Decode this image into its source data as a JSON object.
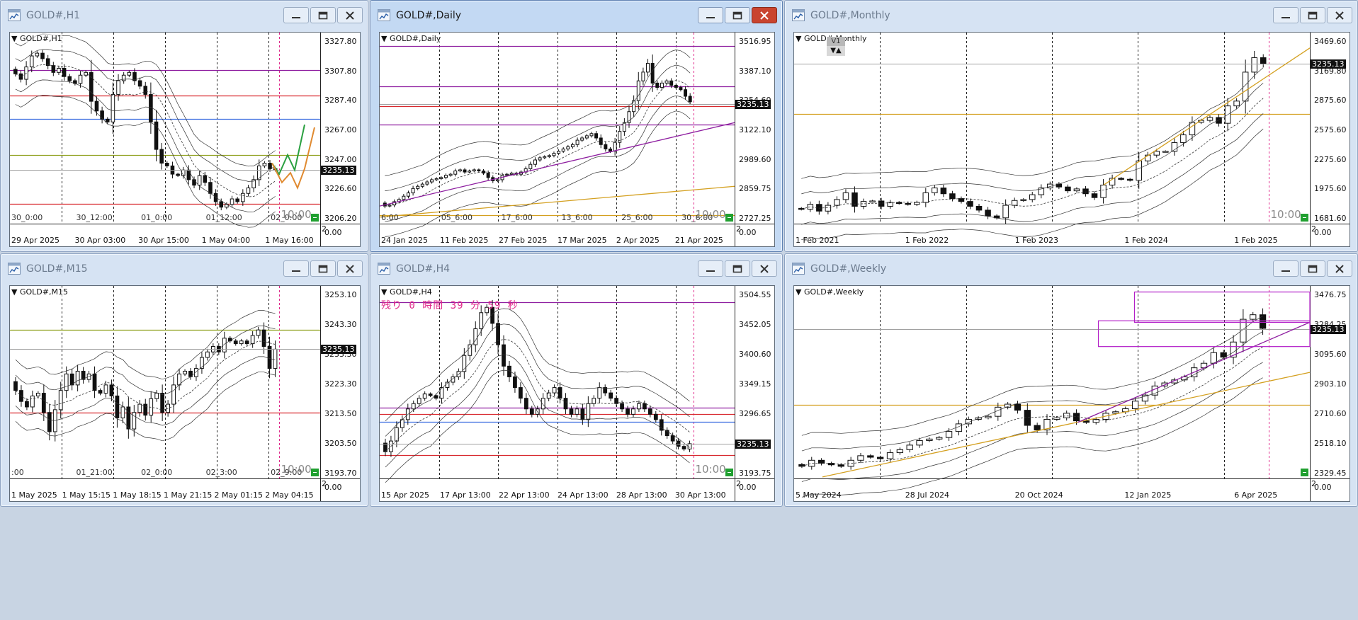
{
  "windows": [
    {
      "title": "GOLD#,H1",
      "symbol": "GOLD#,H1",
      "active": false,
      "price_labels": [
        "3327.80",
        "3307.80",
        "3287.40",
        "3267.00",
        "3247.00",
        "3226.60",
        "3206.20"
      ],
      "current_price": "3235.13",
      "inner_ticks": [
        "30_0:00",
        "30_12:00",
        "01_0:00",
        "01_12:00",
        "02_0:00"
      ],
      "axis_labels": [
        "29 Apr 2025",
        "30 Apr 03:00",
        "30 Apr 15:00",
        "1 May 04:00",
        "1 May 16:00"
      ],
      "time_label": "10:00",
      "scale_top": "2",
      "scale_bottom": "0.00",
      "chart_data": {
        "type": "candlestick",
        "symbol": "GOLD#",
        "timeframe": "H1",
        "y_range": [
          3196,
          3335
        ],
        "last": 3235.13,
        "closes": [
          3305,
          3301,
          3310,
          3318,
          3320,
          3316,
          3311,
          3306,
          3309,
          3303,
          3300,
          3298,
          3304,
          3306,
          3285,
          3278,
          3272,
          3270,
          3290,
          3300,
          3304,
          3306,
          3300,
          3296,
          3290,
          3270,
          3250,
          3240,
          3238,
          3232,
          3231,
          3235,
          3228,
          3224,
          3231,
          3226,
          3218,
          3212,
          3208,
          3210,
          3214,
          3212,
          3218,
          3222,
          3228,
          3238,
          3240,
          3236,
          3235
        ]
      },
      "horizontal_lines": [
        {
          "price": 3307.5,
          "color": "#8e1ea0"
        },
        {
          "price": 3289.0,
          "color": "#d8292f"
        },
        {
          "price": 3272.0,
          "color": "#3a6ce0"
        },
        {
          "price": 3246.0,
          "color": "#8fa01e"
        },
        {
          "price": 3210.5,
          "color": "#d8292f"
        }
      ]
    },
    {
      "title": "GOLD#,Daily",
      "symbol": "GOLD#,Daily",
      "active": true,
      "price_labels": [
        "3516.95",
        "3387.10",
        "3254.60",
        "3122.10",
        "2989.60",
        "2859.75",
        "2727.25"
      ],
      "current_price": "3235.13",
      "inner_ticks": [
        "6:00",
        "05_6:00",
        "17_6:00",
        "13_6:00",
        "25_6:00",
        "30_6:00"
      ],
      "axis_labels": [
        "24 Jan 2025",
        "11 Feb 2025",
        "27 Feb 2025",
        "17 Mar 2025",
        "2 Apr 2025",
        "21 Apr 2025"
      ],
      "time_label": "10:00",
      "scale_top": "2",
      "scale_bottom": "0.00",
      "chart_data": {
        "type": "candlestick",
        "symbol": "GOLD#",
        "timeframe": "D1",
        "y_range": [
          2690,
          3560
        ],
        "last": 3235.13,
        "closes": [
          2770,
          2775,
          2790,
          2800,
          2815,
          2830,
          2850,
          2860,
          2870,
          2880,
          2890,
          2895,
          2900,
          2910,
          2915,
          2930,
          2935,
          2925,
          2930,
          2935,
          2930,
          2920,
          2900,
          2885,
          2890,
          2910,
          2915,
          2920,
          2915,
          2925,
          2940,
          2960,
          2980,
          2990,
          2995,
          3000,
          3010,
          3020,
          3030,
          3040,
          3050,
          3070,
          3080,
          3090,
          3100,
          3080,
          3050,
          3030,
          3020,
          3060,
          3110,
          3150,
          3200,
          3250,
          3340,
          3380,
          3420,
          3330,
          3310,
          3330,
          3340,
          3320,
          3310,
          3300,
          3270,
          3245
        ]
      },
      "horizontal_lines": [
        {
          "price": 3500,
          "color": "#8e1ea0"
        },
        {
          "price": 3316,
          "color": "#8e1ea0"
        },
        {
          "price": 3226,
          "color": "#d8292f"
        },
        {
          "price": 3142,
          "color": "#8e1ea0"
        },
        {
          "price": 2730,
          "color": "#d4a020"
        }
      ]
    },
    {
      "title": "GOLD#,Monthly",
      "symbol": "GOLD#,Monthly",
      "active": false,
      "price_labels": [
        "3469.60",
        "3169.80",
        "2875.60",
        "2575.60",
        "2275.60",
        "1975.60",
        "1681.60"
      ],
      "current_price": "3235.13",
      "inner_ticks": [],
      "axis_labels": [
        "1 Feb 2021",
        "1 Feb 2022",
        "1 Feb 2023",
        "1 Feb 2024",
        "1 Feb 2025"
      ],
      "time_label": "10:00",
      "scale_top": "2",
      "scale_bottom": "0.00",
      "badge": "V1",
      "chart_data": {
        "type": "candlestick",
        "symbol": "GOLD#",
        "timeframe": "MN",
        "y_range": [
          1580,
          3560
        ],
        "last": 3235.13,
        "closes": [
          1730,
          1780,
          1710,
          1770,
          1830,
          1900,
          1760,
          1810,
          1815,
          1760,
          1800,
          1790,
          1780,
          1800,
          1900,
          1950,
          1890,
          1840,
          1810,
          1760,
          1720,
          1660,
          1640,
          1770,
          1820,
          1830,
          1880,
          1950,
          1990,
          1960,
          1920,
          1940,
          1890,
          1850,
          1980,
          2050,
          2040,
          2030,
          2230,
          2290,
          2330,
          2330,
          2420,
          2500,
          2630,
          2650,
          2680,
          2620,
          2800,
          2850,
          3150,
          3300,
          3235
        ]
      },
      "horizontal_lines": [
        {
          "price": 2720,
          "color": "#d4a020"
        }
      ]
    },
    {
      "title": "GOLD#,M15",
      "symbol": "GOLD#,M15",
      "active": false,
      "price_labels": [
        "3253.10",
        "3243.30",
        "3233.30",
        "3223.30",
        "3213.50",
        "3203.50",
        "3193.70"
      ],
      "current_price": "3235.13",
      "inner_ticks": [
        ":00",
        "01_21:00",
        "02_0:00",
        "02_3:00",
        "02_9:00"
      ],
      "axis_labels": [
        "1 May 2025",
        "1 May 15:15",
        "1 May 18:15",
        "1 May 21:15",
        "2 May 01:15",
        "2 May 04:15"
      ],
      "time_label": "10:00",
      "scale_top": "2",
      "scale_bottom": "0.00",
      "chart_data": {
        "type": "candlestick",
        "symbol": "GOLD#",
        "timeframe": "M15",
        "y_range": [
          3188,
          3258
        ],
        "last": 3235.13,
        "closes": [
          3220,
          3216,
          3214,
          3218,
          3219,
          3212,
          3205,
          3213,
          3220,
          3226,
          3222,
          3227,
          3224,
          3226,
          3220,
          3219,
          3222,
          3218,
          3210,
          3214,
          3206,
          3212,
          3215,
          3211,
          3217,
          3219,
          3212,
          3215,
          3222,
          3226,
          3227,
          3225,
          3228,
          3232,
          3234,
          3236,
          3234,
          3239,
          3238,
          3237,
          3238,
          3237,
          3240,
          3242,
          3236,
          3228,
          3235
        ]
      },
      "horizontal_lines": [
        {
          "price": 3242,
          "color": "#8fa01e"
        },
        {
          "price": 3212,
          "color": "#d8292f"
        }
      ]
    },
    {
      "title": "GOLD#,H4",
      "symbol": "GOLD#,H4",
      "active": false,
      "countdown": "残り 0 時間 39 分 59 秒",
      "price_labels": [
        "3504.55",
        "3452.05",
        "3400.60",
        "3349.15",
        "3296.65",
        "3245.20",
        "3193.75"
      ],
      "current_price": "3235.13",
      "inner_ticks": [],
      "axis_labels": [
        "15 Apr 2025",
        "17 Apr 13:00",
        "22 Apr 13:00",
        "24 Apr 13:00",
        "28 Apr 13:00",
        "30 Apr 13:00"
      ],
      "time_label": "10:00",
      "scale_top": "2",
      "scale_bottom": "0.00",
      "chart_data": {
        "type": "candlestick",
        "symbol": "GOLD#",
        "timeframe": "H4",
        "y_range": [
          3170,
          3530
        ],
        "last": 3235.13,
        "closes": [
          3220,
          3240,
          3265,
          3280,
          3300,
          3310,
          3320,
          3328,
          3325,
          3320,
          3340,
          3350,
          3360,
          3370,
          3400,
          3420,
          3450,
          3480,
          3490,
          3460,
          3420,
          3380,
          3360,
          3340,
          3320,
          3300,
          3290,
          3300,
          3320,
          3330,
          3340,
          3320,
          3300,
          3290,
          3300,
          3280,
          3310,
          3320,
          3340,
          3330,
          3320,
          3310,
          3300,
          3290,
          3300,
          3310,
          3300,
          3290,
          3280,
          3260,
          3250,
          3240,
          3230,
          3225,
          3235
        ]
      },
      "horizontal_lines": [
        {
          "price": 3500,
          "color": "#8e1ea0"
        },
        {
          "price": 3303,
          "color": "#8e1ea0"
        },
        {
          "price": 3290,
          "color": "#d8292f"
        },
        {
          "price": 3276,
          "color": "#3a6ce0"
        },
        {
          "price": 3214,
          "color": "#d8292f"
        }
      ]
    },
    {
      "title": "GOLD#,Weekly",
      "symbol": "GOLD#,Weekly",
      "active": false,
      "price_labels": [
        "3476.75",
        "3284.25",
        "3095.60",
        "2903.10",
        "2710.60",
        "2518.10",
        "2329.45"
      ],
      "current_price": "3235.13",
      "inner_ticks": [],
      "axis_labels": [
        "5 May 2024",
        "28 Jul 2024",
        "20 Oct 2024",
        "12 Jan 2025",
        "6 Apr 2025"
      ],
      "time_label": "",
      "scale_top": "2",
      "scale_bottom": "0.00",
      "chart_data": {
        "type": "candlestick",
        "symbol": "GOLD#",
        "timeframe": "W1",
        "y_range": [
          2250,
          3520
        ],
        "last": 3235.13,
        "closes": [
          2330,
          2370,
          2350,
          2340,
          2330,
          2370,
          2400,
          2390,
          2380,
          2420,
          2440,
          2470,
          2500,
          2510,
          2520,
          2560,
          2610,
          2640,
          2650,
          2660,
          2720,
          2740,
          2700,
          2600,
          2570,
          2640,
          2650,
          2680,
          2630,
          2620,
          2640,
          2680,
          2690,
          2710,
          2760,
          2800,
          2860,
          2880,
          2900,
          2920,
          2980,
          3010,
          3080,
          3050,
          3150,
          3300,
          3330,
          3240
        ]
      },
      "horizontal_lines": [
        {
          "price": 2735,
          "color": "#d4a020"
        }
      ]
    }
  ]
}
